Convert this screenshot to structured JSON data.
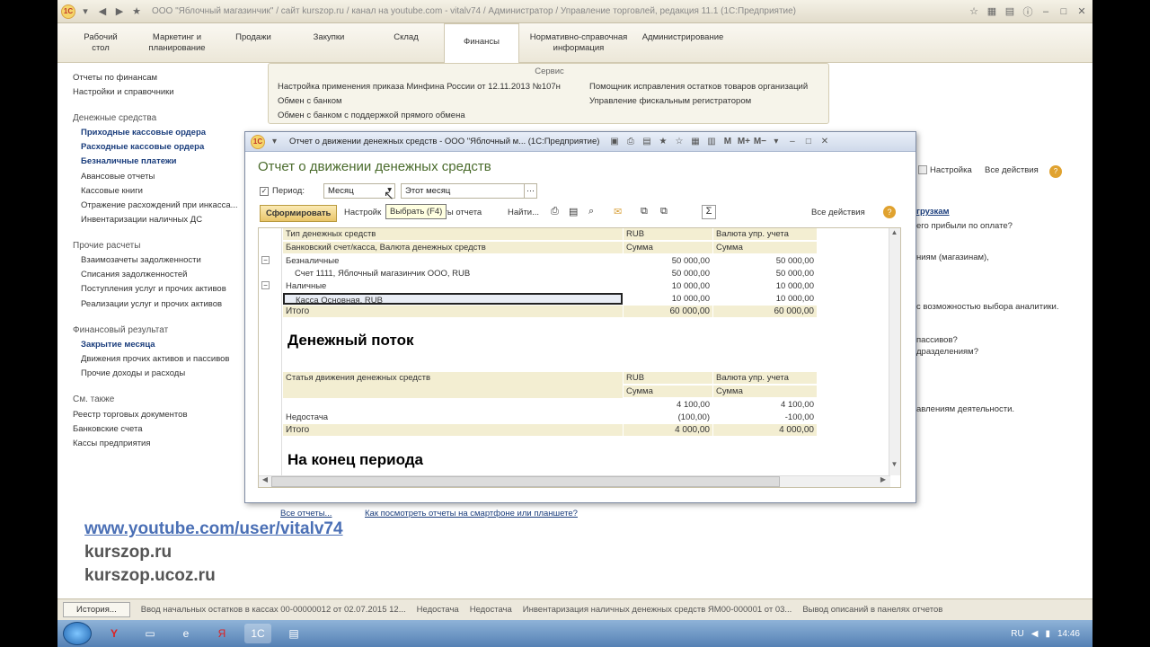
{
  "app": {
    "title": "ООО \"Яблочный магазинчик\" / сайт kurszop.ru / канал на youtube.com - vitalv74 / Администратор / Управление торговлей, редакция 11.1  (1С:Предприятие)"
  },
  "nav_tabs": [
    {
      "label": "Рабочий\nстол"
    },
    {
      "label": "Маркетинг и\nпланирование"
    },
    {
      "label": "Продажи"
    },
    {
      "label": "Закупки"
    },
    {
      "label": "Склад"
    },
    {
      "label": "Финансы"
    },
    {
      "label": "Нормативно-справочная\nинформация"
    },
    {
      "label": "Администрирование"
    }
  ],
  "sidebar": {
    "top_links": [
      "Отчеты по финансам",
      "Настройки и справочники"
    ],
    "money": {
      "title": "Денежные средства",
      "items": [
        "Приходные кассовые ордера",
        "Расходные кассовые ордера",
        "Безналичные платежи",
        "Авансовые отчеты",
        "Кассовые книги",
        "Отражение расхождений при инкасса...",
        "Инвентаризации наличных ДС"
      ]
    },
    "other": {
      "title": "Прочие расчеты",
      "items": [
        "Взаимозачеты задолженности",
        "Списания задолженностей",
        "Поступления услуг и прочих активов",
        "Реализации услуг и прочих активов"
      ]
    },
    "fin": {
      "title": "Финансовый результат",
      "items": [
        "Закрытие месяца",
        "Движения прочих активов и пассивов",
        "Прочие доходы и расходы"
      ]
    },
    "see": {
      "title": "См. также",
      "items": [
        "Реестр торговых документов",
        "Банковские счета",
        "Кассы предприятия"
      ]
    }
  },
  "service": {
    "title": "Сервис",
    "left": [
      "Настройка применения приказа Минфина России от 12.11.2013 №107н",
      "Обмен с банком",
      "Обмен с банком с поддержкой прямого обмена"
    ],
    "right": [
      "Помощник исправления остатков товаров организаций",
      "Управление фискальным регистратором"
    ]
  },
  "background_right": {
    "toolbar_settings": "Настройка",
    "toolbar_all_actions": "Все действия",
    "link": "грузкам",
    "lines": [
      "его прибыли по оплате?",
      "ниям (магазинам),",
      "с возможностью выбора аналитики.",
      "пассивов?",
      "дразделениям?",
      "авлениям деятельности."
    ]
  },
  "report": {
    "window_title": "Отчет о движении денежных средств - ООО \"Яблочный м...  (1С:Предприятие)",
    "heading": "Отчет о движении денежных средств",
    "period_label": "Период:",
    "period_value": "Месяц",
    "period_select": "Этот месяц",
    "tooltip": "Выбрать (F4)",
    "generate": "Сформировать",
    "settings": "Настройк",
    "variants": "анты отчета",
    "find": "Найти...",
    "sum_icon": "Σ",
    "all_actions": "Все действия",
    "section1": {
      "headers": [
        "Тип денежных средств",
        "RUB",
        "Валюта упр. учета"
      ],
      "subheaders": [
        "Банковский счет/касса, Валюта денежных средств",
        "Сумма",
        "Сумма"
      ],
      "rows": [
        {
          "name": "Безналичные",
          "rub": "50 000,00",
          "mgmt": "50 000,00"
        },
        {
          "name": "Счет 1111, Яблочный магазинчик ООО, RUB",
          "rub": "50 000,00",
          "mgmt": "50 000,00"
        },
        {
          "name": "Наличные",
          "rub": "10 000,00",
          "mgmt": "10 000,00"
        },
        {
          "name": "Касса Основная, RUB",
          "rub": "10 000,00",
          "mgmt": "10 000,00"
        }
      ],
      "total": {
        "name": "Итого",
        "rub": "60 000,00",
        "mgmt": "60 000,00"
      }
    },
    "cashflow_title": "Денежный поток",
    "section2": {
      "headers": [
        "Статья движения денежных средств",
        "RUB",
        "Валюта упр. учета"
      ],
      "subheaders": [
        "",
        "Сумма",
        "Сумма"
      ],
      "rows": [
        {
          "name": "",
          "rub": "4 100,00",
          "mgmt": "4 100,00"
        },
        {
          "name": "Недостача",
          "rub": "(100,00)",
          "mgmt": "-100,00"
        }
      ],
      "total": {
        "name": "Итого",
        "rub": "4 000,00",
        "mgmt": "4 000,00"
      }
    },
    "end_title": "На конец периода"
  },
  "bottom_links": {
    "all_reports": "Все отчеты...",
    "phone": "Как посмотреть отчеты на смартфоне или планшете?"
  },
  "watermark": [
    "www.youtube.com/user/vitalv74",
    "kurszop.ru",
    "kurszop.ucoz.ru"
  ],
  "history": {
    "button": "История...",
    "items": [
      "Ввод начальных остатков в кассах 00-00000012 от 02.07.2015 12...",
      "Недостача",
      "Недостача",
      "Инвентаризация наличных денежных средств ЯМ00-000001 от 03...",
      "Вывод описаний в панелях отчетов"
    ]
  },
  "taskbar": {
    "lang": "RU",
    "time": "14:46"
  }
}
